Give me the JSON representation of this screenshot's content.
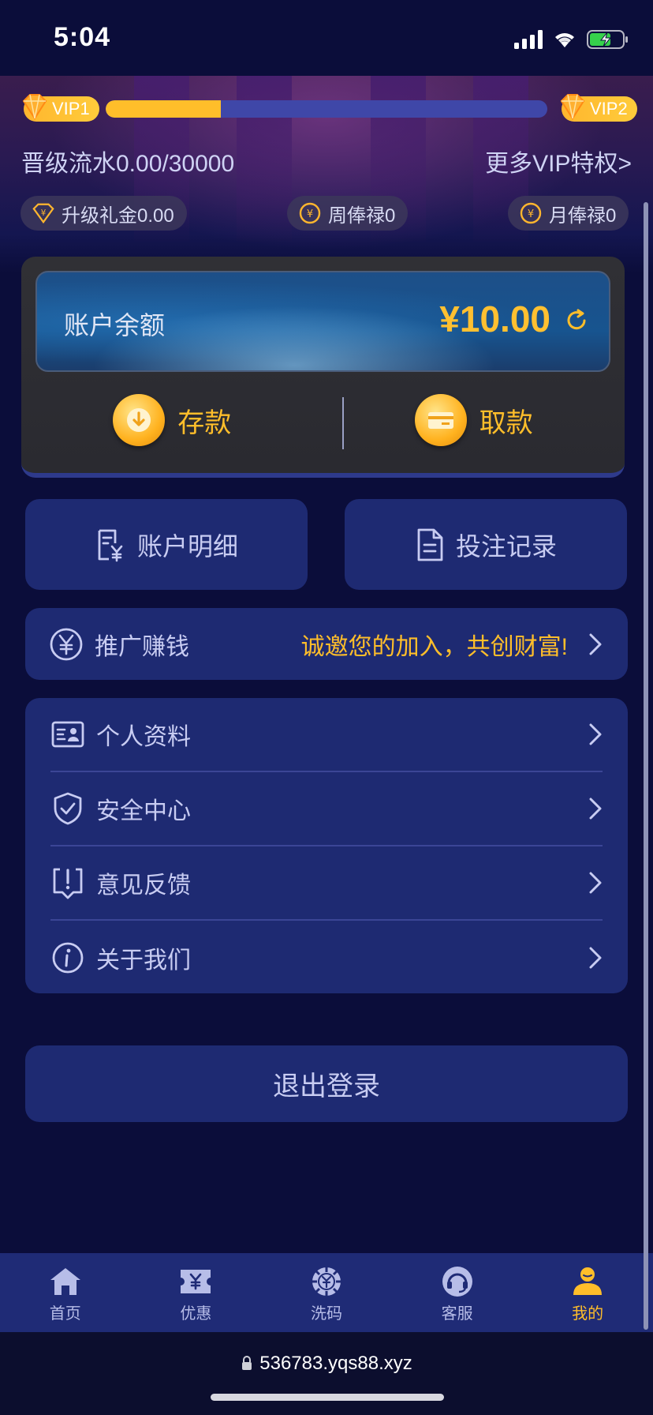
{
  "status_bar": {
    "time": "5:04"
  },
  "vip": {
    "current_label": "VIP1",
    "next_label": "VIP2",
    "progress_fraction": 0.26,
    "upgrade_text": "晋级流水0.00/30000",
    "more_link": "更多VIP特权>"
  },
  "chips": [
    {
      "label": "升级礼金0.00",
      "icon": "diamond-yen-icon"
    },
    {
      "label": "周俸禄0",
      "icon": "yen-coin-icon"
    },
    {
      "label": "月俸禄0",
      "icon": "yen-coin-icon"
    }
  ],
  "balance": {
    "label": "账户余额",
    "amount": "¥10.00",
    "deposit_label": "存款",
    "withdraw_label": "取款"
  },
  "tiles": {
    "account_detail": "账户明细",
    "bet_record": "投注记录"
  },
  "promo": {
    "label": "推广赚钱",
    "slogan": "诚邀您的加入，共创财富!"
  },
  "menu": {
    "items": [
      {
        "label": "个人资料",
        "icon": "id-card-icon"
      },
      {
        "label": "安全中心",
        "icon": "shield-icon"
      },
      {
        "label": "意见反馈",
        "icon": "feedback-icon"
      },
      {
        "label": "关于我们",
        "icon": "info-icon"
      }
    ]
  },
  "logout_label": "退出登录",
  "tab_bar": {
    "items": [
      {
        "label": "首页",
        "icon": "home-icon"
      },
      {
        "label": "优惠",
        "icon": "ticket-icon"
      },
      {
        "label": "洗码",
        "icon": "chip-icon"
      },
      {
        "label": "客服",
        "icon": "headset-icon"
      },
      {
        "label": "我的",
        "icon": "user-icon"
      }
    ],
    "active_index": 4
  },
  "url_bar": {
    "url": "536783.yqs88.xyz"
  },
  "colors": {
    "accent": "#ffbe2a",
    "card": "#1e2a72",
    "background": "#0b0d3a",
    "progress_track": "#3f47a8"
  }
}
